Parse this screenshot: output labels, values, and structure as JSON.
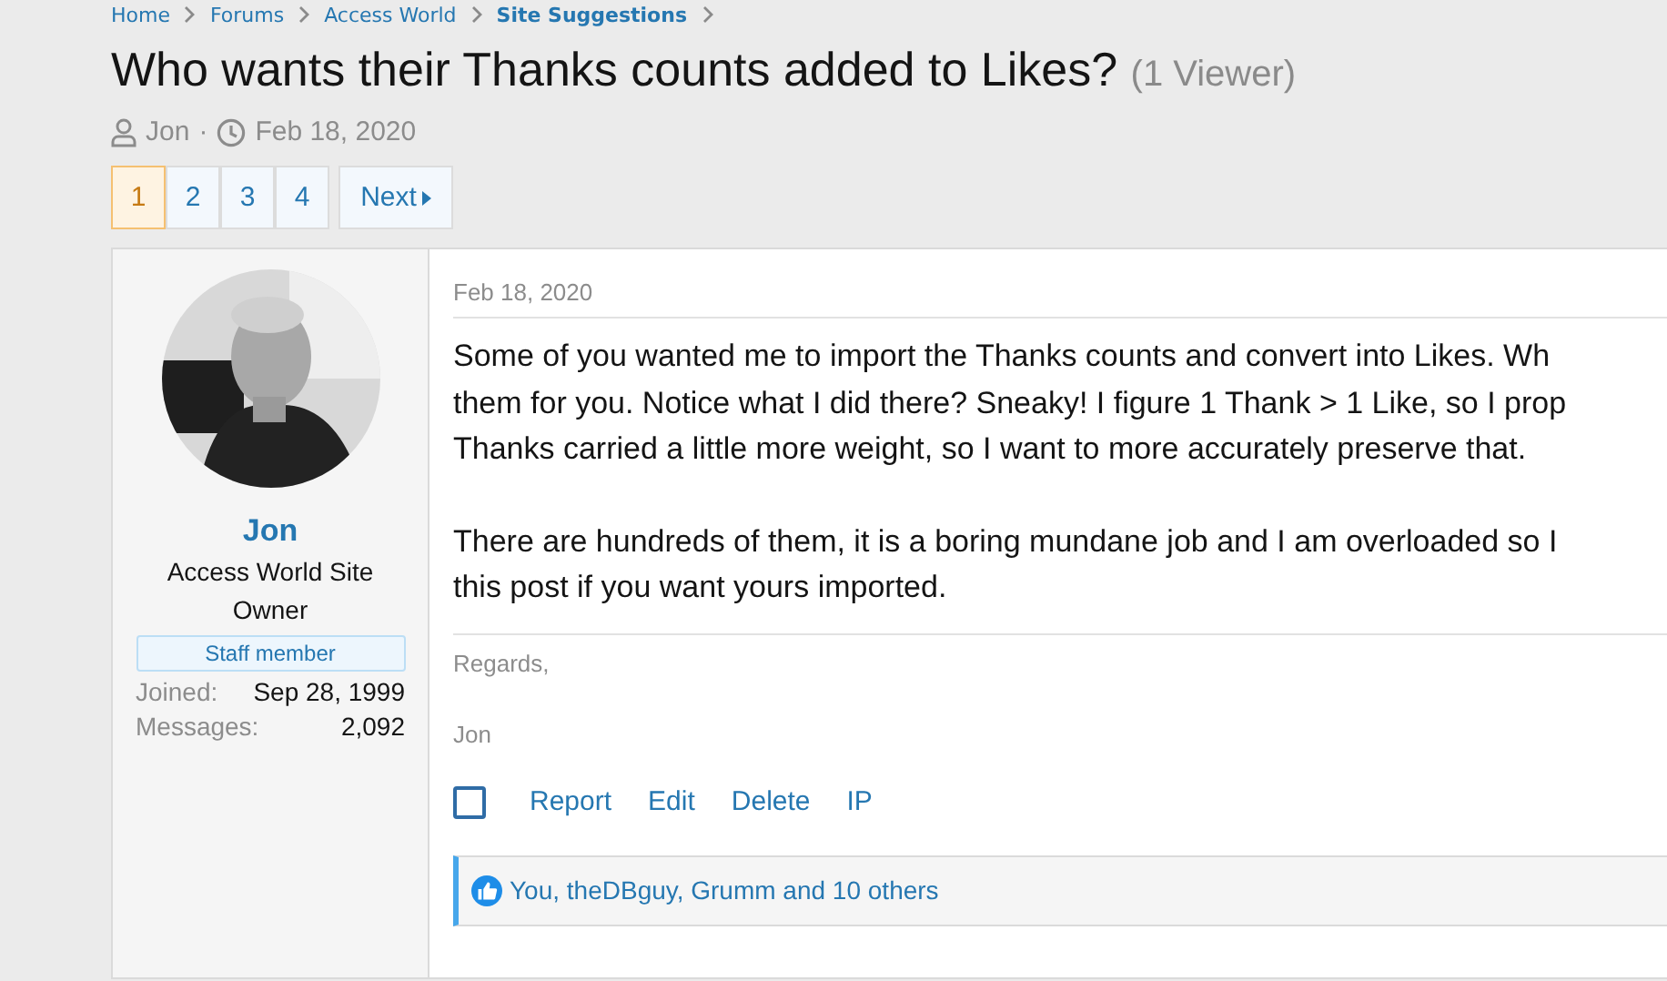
{
  "breadcrumb": [
    "Home",
    "Forums",
    "Access World",
    "Site Suggestions"
  ],
  "thread": {
    "title": "Who wants their Thanks counts added to Likes?",
    "viewers": "(1 Viewer)",
    "author": "Jon",
    "separator": "·",
    "date": "Feb 18, 2020"
  },
  "pagination": {
    "pages": [
      {
        "label": "1",
        "selected": true
      },
      {
        "label": "2",
        "selected": false
      },
      {
        "label": "3",
        "selected": false
      },
      {
        "label": "4",
        "selected": false
      }
    ],
    "next": "Next"
  },
  "post": {
    "user": {
      "name": "Jon",
      "title": "Access World Site Owner",
      "badge": "Staff member",
      "stats": [
        {
          "label": "Joined:",
          "value": "Sep 28, 1999"
        },
        {
          "label": "Messages:",
          "value": "2,092"
        }
      ]
    },
    "date": "Feb 18, 2020",
    "paragraphs": [
      [
        "Some of you wanted me to import the Thanks counts and convert into Likes. Wh",
        "them for you. Notice what I did there? Sneaky! I figure 1 Thank > 1 Like, so I prop",
        "Thanks carried a little more weight, so I want to more accurately preserve that."
      ],
      [
        "There are hundreds of them, it is a boring mundane job and I am overloaded so I",
        "this post if you want yours imported."
      ]
    ],
    "signature": [
      "Regards,",
      "Jon"
    ],
    "select_checked": false,
    "actions": [
      "Report",
      "Edit",
      "Delete",
      "IP"
    ],
    "reactions": "You, theDBguy, Grumm and 10 others"
  }
}
